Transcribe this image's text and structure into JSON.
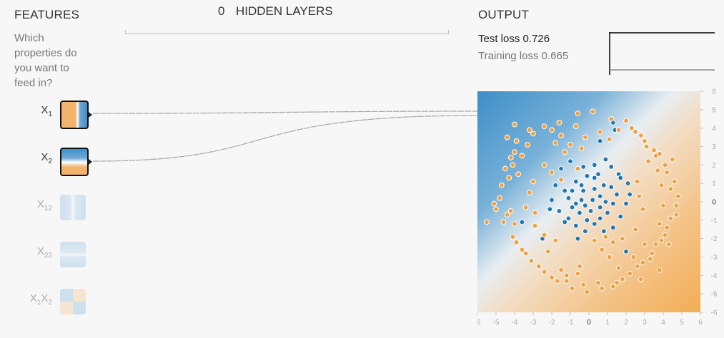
{
  "features": {
    "title": "FEATURES",
    "prompt": "Which properties do you want to feed in?",
    "items": [
      {
        "label": "X",
        "sub": "1",
        "active": true
      },
      {
        "label": "X",
        "sub": "2",
        "active": true
      },
      {
        "label": "X",
        "sub": "12",
        "active": false
      },
      {
        "label": "X",
        "sub": "22",
        "active": false
      },
      {
        "label": "X",
        "sub": "1",
        "label2": "X",
        "sub2": "2",
        "active": false
      }
    ]
  },
  "hidden_layers": {
    "count": "0",
    "title": "HIDDEN LAYERS"
  },
  "output": {
    "title": "OUTPUT",
    "test_loss_label": "Test loss",
    "test_loss_value": "0.726",
    "training_loss_label": "Training loss",
    "training_loss_value": "0.665"
  },
  "chart_data": {
    "type": "scatter",
    "x_ticks": [
      -6,
      -5,
      -4,
      -3,
      -2,
      -1,
      0,
      1,
      2,
      3,
      4,
      5,
      6
    ],
    "y_ticks": [
      6,
      5,
      4,
      3,
      2,
      1,
      0,
      -1,
      -2,
      -3,
      -4,
      -5,
      -6
    ],
    "xlim": [
      -6,
      6
    ],
    "ylim": [
      -6,
      6
    ],
    "background": "linear decision boundary: blue upper-left, orange lower-right",
    "colors": {
      "blue": "#1f77b4",
      "orange": "#f0a040"
    },
    "series": [
      {
        "color": "blue",
        "points": [
          [
            0.9,
            2.3
          ],
          [
            0.3,
            2.0
          ],
          [
            -0.3,
            1.9
          ],
          [
            -1.0,
            2.2
          ],
          [
            -1.5,
            1.8
          ],
          [
            -1.8,
            0.9
          ],
          [
            -2.0,
            0.1
          ],
          [
            -2.1,
            -0.4
          ],
          [
            -1.6,
            -0.5
          ],
          [
            -1.1,
            -0.9
          ],
          [
            -0.7,
            -1.3
          ],
          [
            -0.2,
            -1.6
          ],
          [
            0.3,
            -1.2
          ],
          [
            0.8,
            -1.6
          ],
          [
            1.3,
            -1.4
          ],
          [
            1.7,
            -0.8
          ],
          [
            2.0,
            -0.1
          ],
          [
            2.2,
            0.4
          ],
          [
            2.1,
            1.0
          ],
          [
            1.6,
            1.5
          ],
          [
            1.2,
            1.9
          ],
          [
            0.5,
            1.5
          ],
          [
            -0.1,
            1.4
          ],
          [
            -0.7,
            1.1
          ],
          [
            -0.9,
            0.6
          ],
          [
            -1.1,
            0.2
          ],
          [
            -0.9,
            -0.3
          ],
          [
            -0.5,
            -0.6
          ],
          [
            0.1,
            -0.5
          ],
          [
            0.6,
            -0.9
          ],
          [
            1.0,
            -0.6
          ],
          [
            1.3,
            -0.1
          ],
          [
            1.5,
            0.4
          ],
          [
            1.2,
            0.8
          ],
          [
            0.8,
            0.9
          ],
          [
            0.3,
            0.7
          ],
          [
            -0.3,
            0.6
          ],
          [
            -0.4,
            0.1
          ],
          [
            -0.2,
            -0.2
          ],
          [
            0.2,
            0.1
          ],
          [
            0.6,
            0.3
          ],
          [
            0.9,
            0.0
          ],
          [
            0.6,
            -0.3
          ],
          [
            -0.7,
            -0.1
          ],
          [
            -1.3,
            0.6
          ],
          [
            1.3,
            4.3
          ],
          [
            1.4,
            3.9
          ],
          [
            0.6,
            3.3
          ],
          [
            -2.5,
            -2.0
          ],
          [
            -0.6,
            -2.0
          ],
          [
            2.0,
            -2.7
          ],
          [
            0.3,
            1.3
          ],
          [
            -0.4,
            0.9
          ],
          [
            -0.1,
            -1.0
          ],
          [
            -1.3,
            -1.1
          ],
          [
            1.7,
            1.3
          ],
          [
            -3.6,
            -1.1
          ]
        ]
      },
      {
        "color": "orange",
        "points": [
          [
            -5.0,
            -0.4
          ],
          [
            -4.8,
            0.2
          ],
          [
            -4.7,
            0.9
          ],
          [
            -4.3,
            1.3
          ],
          [
            -4.1,
            2.0
          ],
          [
            -3.6,
            2.5
          ],
          [
            -3.3,
            3.1
          ],
          [
            -3.0,
            3.7
          ],
          [
            -2.4,
            4.1
          ],
          [
            -1.6,
            4.3
          ],
          [
            -0.6,
            4.8
          ],
          [
            0.2,
            4.9
          ],
          [
            1.2,
            4.5
          ],
          [
            2.0,
            4.4
          ],
          [
            2.5,
            3.8
          ],
          [
            3.1,
            3.0
          ],
          [
            3.6,
            2.5
          ],
          [
            4.1,
            2.0
          ],
          [
            4.6,
            1.1
          ],
          [
            4.8,
            0.3
          ],
          [
            4.7,
            -0.7
          ],
          [
            4.2,
            -1.4
          ],
          [
            3.9,
            -2.1
          ],
          [
            3.4,
            -2.8
          ],
          [
            2.9,
            -3.3
          ],
          [
            2.2,
            -3.9
          ],
          [
            1.5,
            -4.4
          ],
          [
            0.7,
            -4.7
          ],
          [
            -0.1,
            -4.9
          ],
          [
            -0.9,
            -4.7
          ],
          [
            -1.7,
            -4.3
          ],
          [
            -2.4,
            -3.8
          ],
          [
            -3.1,
            -3.2
          ],
          [
            -3.6,
            -2.6
          ],
          [
            -4.1,
            -1.9
          ],
          [
            -4.6,
            -1.1
          ],
          [
            -5.5,
            -1.1
          ],
          [
            -5.1,
            -0.1
          ],
          [
            -4.4,
            -0.7
          ],
          [
            -4.0,
            -1.2
          ],
          [
            -4.5,
            1.8
          ],
          [
            -4.2,
            2.4
          ],
          [
            -3.9,
            3.3
          ],
          [
            -3.2,
            3.9
          ],
          [
            -1.5,
            3.6
          ],
          [
            -0.7,
            4.1
          ],
          [
            -0.2,
            3.5
          ],
          [
            0.6,
            3.8
          ],
          [
            1.6,
            3.9
          ],
          [
            2.3,
            4.0
          ],
          [
            3.0,
            3.3
          ],
          [
            3.5,
            2.8
          ],
          [
            3.8,
            2.6
          ],
          [
            4.2,
            1.6
          ],
          [
            4.4,
            0.7
          ],
          [
            4.0,
            -0.2
          ],
          [
            4.4,
            -0.9
          ],
          [
            4.1,
            -1.8
          ],
          [
            3.6,
            -2.3
          ],
          [
            3.3,
            -3.1
          ],
          [
            2.6,
            -3.5
          ],
          [
            1.8,
            -4.2
          ],
          [
            1.3,
            -4.6
          ],
          [
            0.5,
            -4.4
          ],
          [
            -0.3,
            -4.5
          ],
          [
            -1.2,
            -4.0
          ],
          [
            -2.0,
            -4.1
          ],
          [
            -2.7,
            -3.5
          ],
          [
            -3.4,
            -2.8
          ],
          [
            -3.9,
            -2.2
          ],
          [
            -4.2,
            -0.5
          ],
          [
            -3.8,
            1.5
          ],
          [
            -4.0,
            2.7
          ],
          [
            -4.4,
            3.5
          ],
          [
            -4.0,
            4.2
          ],
          [
            -2.0,
            3.9
          ],
          [
            -1.0,
            3.1
          ],
          [
            1.1,
            3.4
          ],
          [
            2.8,
            3.6
          ],
          [
            3.2,
            2.2
          ],
          [
            4.5,
            2.3
          ],
          [
            4.7,
            -0.2
          ],
          [
            4.3,
            -2.3
          ],
          [
            3.8,
            -3.7
          ],
          [
            2.8,
            -4.2
          ],
          [
            1.6,
            -3.6
          ],
          [
            1.1,
            -3.0
          ],
          [
            0.3,
            -2.1
          ],
          [
            0.9,
            -1.9
          ],
          [
            1.3,
            -2.2
          ],
          [
            0.7,
            -2.6
          ],
          [
            1.8,
            -2.0
          ],
          [
            2.4,
            -3.0
          ],
          [
            -1.5,
            -3.7
          ],
          [
            -0.6,
            -3.9
          ],
          [
            -0.5,
            -3.5
          ],
          [
            -1.2,
            -4.3
          ],
          [
            -2.4,
            -1.8
          ],
          [
            -2.9,
            -1.3
          ],
          [
            -1.8,
            -2.1
          ],
          [
            -2.2,
            -2.7
          ],
          [
            -2.0,
            1.6
          ],
          [
            -2.4,
            2.0
          ],
          [
            -1.8,
            3.2
          ],
          [
            -1.3,
            2.7
          ],
          [
            -0.4,
            2.9
          ],
          [
            -0.6,
            1.8
          ],
          [
            -1.5,
            1.2
          ],
          [
            2.6,
            1.1
          ],
          [
            2.7,
            0.3
          ],
          [
            2.9,
            -0.4
          ],
          [
            2.5,
            -1.5
          ],
          [
            3.0,
            -2.3
          ],
          [
            3.8,
            -1.2
          ],
          [
            3.9,
            0.9
          ],
          [
            3.7,
            1.7
          ],
          [
            -3.2,
            0.5
          ],
          [
            -3.0,
            1.1
          ],
          [
            -2.9,
            -0.6
          ],
          [
            -3.4,
            -0.3
          ]
        ]
      }
    ]
  }
}
